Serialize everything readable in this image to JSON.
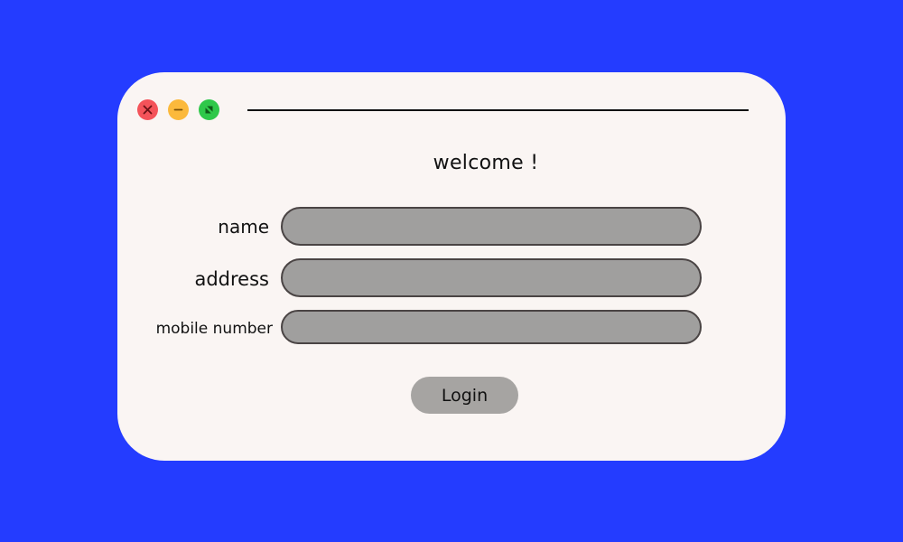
{
  "window": {
    "controls": {
      "close_icon": "close-icon",
      "minimize_icon": "minimize-icon",
      "maximize_icon": "maximize-icon"
    },
    "heading": "welcome !"
  },
  "form": {
    "fields": [
      {
        "label": "name",
        "value": "",
        "placeholder": ""
      },
      {
        "label": "address",
        "value": "",
        "placeholder": ""
      },
      {
        "label": "mobile number",
        "value": "",
        "placeholder": ""
      }
    ],
    "submit_label": "Login"
  },
  "colors": {
    "background": "#243cff",
    "window": "#faf5f3",
    "close": "#f4535a",
    "minimize": "#fbb93c",
    "maximize": "#2fc84a",
    "field_fill": "#a09f9e",
    "button_fill": "#a6a4a2"
  }
}
